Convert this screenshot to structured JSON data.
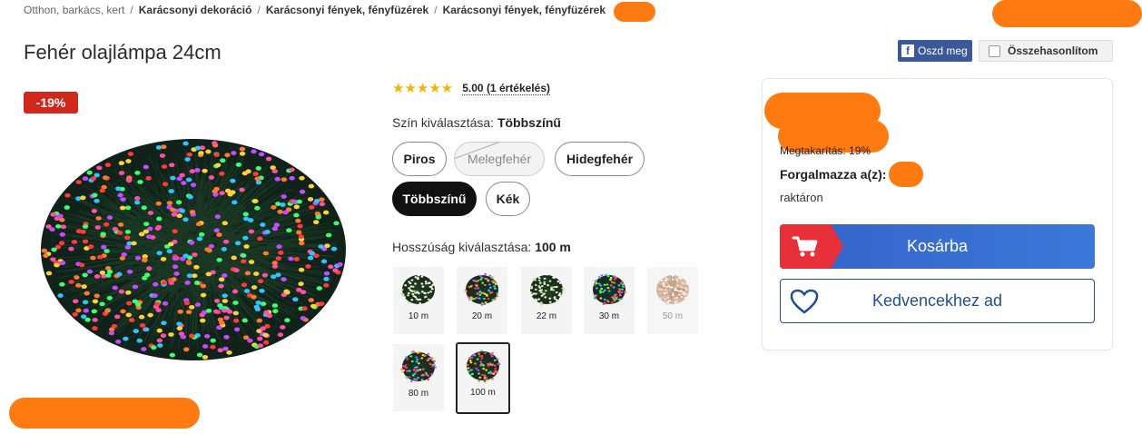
{
  "breadcrumb": {
    "items": [
      "Otthon, barkács, kert",
      "Karácsonyi dekoráció",
      "Karácsonyi fények, fényfüzérek",
      "Karácsonyi fények, fényfüzérek"
    ],
    "separator": "/"
  },
  "product": {
    "title": "Fehér olajlámpa 24cm",
    "discount_badge": "-19%",
    "image_icon": "christmas-light-string-image"
  },
  "share": {
    "label": "Oszd meg",
    "icon": "facebook-icon",
    "icon_glyph": "f",
    "color": "#3b5998"
  },
  "compare": {
    "label": "Összehasonlítom"
  },
  "rating": {
    "stars": "★★★★★",
    "value": 5,
    "link_text": "5.00 (1 értékelés)"
  },
  "color_option": {
    "label": "Szín kiválasztása:",
    "selected": "Többszínű",
    "options": [
      {
        "label": "Piros",
        "state": "available"
      },
      {
        "label": "Melegfehér",
        "state": "disabled"
      },
      {
        "label": "Hidegfehér",
        "state": "available"
      },
      {
        "label": "Többszínű",
        "state": "selected"
      },
      {
        "label": "Kék",
        "state": "available"
      }
    ]
  },
  "length_option": {
    "label": "Hosszúság kiválasztása:",
    "selected": "100 m",
    "options": [
      {
        "label": "10 m",
        "state": "available"
      },
      {
        "label": "20 m",
        "state": "available"
      },
      {
        "label": "22 m",
        "state": "available"
      },
      {
        "label": "30 m",
        "state": "available"
      },
      {
        "label": "50 m",
        "state": "disabled"
      },
      {
        "label": "80 m",
        "state": "available"
      },
      {
        "label": "100 m",
        "state": "selected"
      }
    ]
  },
  "purchase": {
    "saving": "Megtakarítás: 19%",
    "distributor_label": "Forgalmazza a(z):",
    "stock": "raktáron",
    "cart_label": "Kosárba",
    "favorite_label": "Kedvencekhez ad",
    "cart_accent": "#e8303a",
    "primary_color": "#3b78d8"
  }
}
